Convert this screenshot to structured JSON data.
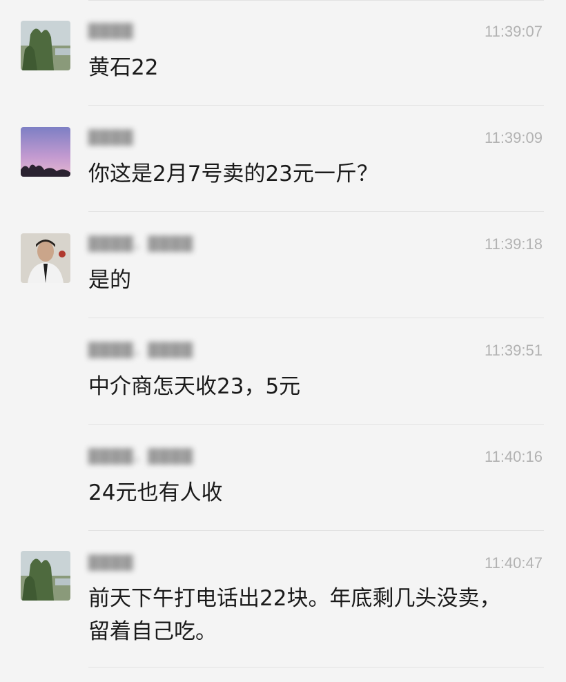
{
  "messages": [
    {
      "sender": "████",
      "time": "11:39:07",
      "text": "黄石22"
    },
    {
      "sender": "████",
      "time": "11:39:09",
      "text": "你这是2月7号卖的23元一斤？"
    },
    {
      "sender": "████，████",
      "time": "11:39:18",
      "text": "是的"
    },
    {
      "sender": "████，████",
      "time": "11:39:51",
      "text": "中介商怎天收23，5元"
    },
    {
      "sender": "████，████",
      "time": "11:40:16",
      "text": "24元也有人收"
    },
    {
      "sender": "████",
      "time": "11:40:47",
      "text": "前天下午打电话出22块。年底剩几头没卖，留着自己吃。"
    }
  ]
}
